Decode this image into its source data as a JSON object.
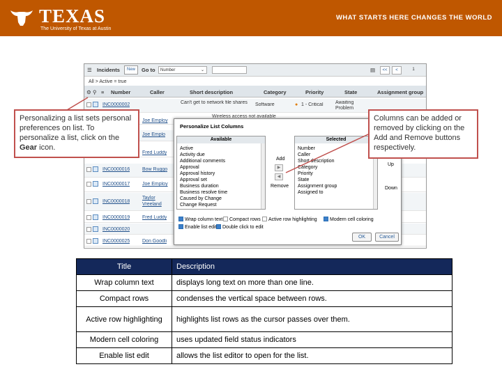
{
  "banner": {
    "logo_word": "TEXAS",
    "logo_sub": "The University of Texas at Austin",
    "tagline": "WHAT STARTS HERE CHANGES THE WORLD",
    "color": "#bf5700"
  },
  "screenshot": {
    "toolbar": {
      "list_name": "Incidents",
      "new_label": "New",
      "goto_label": "Go to",
      "goto_select": "Number",
      "first_page": "<<",
      "prev_page": "<",
      "page_number": "1"
    },
    "breadcrumb": "All > Active = true",
    "columns": [
      "Number",
      "Caller",
      "Short description",
      "Category",
      "Priority",
      "State",
      "Assignment group"
    ],
    "rows": [
      {
        "number": "INC0000002",
        "caller": "",
        "short_description": "Can't get to network file shares",
        "category": "Software",
        "priority": "1 - Critical",
        "state": "Awaiting Problem"
      },
      {
        "number": "",
        "caller": "Joe Employ",
        "short_description": "Wireless access not available",
        "category": "",
        "priority": "",
        "state": ""
      },
      {
        "number": "",
        "caller": "Joe Emplo",
        "short_description": "",
        "category": "",
        "priority": "",
        "state": ""
      },
      {
        "number": "",
        "caller": "Fred Luddy",
        "short_description": "",
        "category": "",
        "priority": "",
        "state": ""
      },
      {
        "number": "INC0000016",
        "caller": "Bow Ruggo",
        "short_description": "",
        "category": "",
        "priority": "",
        "state": ""
      },
      {
        "number": "INC0000017",
        "caller": "Joe Employ",
        "short_description": "",
        "category": "",
        "priority": "",
        "state": ""
      },
      {
        "number": "INC0000018",
        "caller": "Taylor Vreeland",
        "short_description": "",
        "category": "",
        "priority": "",
        "state": ""
      },
      {
        "number": "INC0000019",
        "caller": "Fred Luddy",
        "short_description": "",
        "category": "",
        "priority": "",
        "state": ""
      },
      {
        "number": "INC0000020",
        "caller": "",
        "short_description": "",
        "category": "",
        "priority": "",
        "state": ""
      },
      {
        "number": "INC0000025",
        "caller": "Don Goodli",
        "short_description": "",
        "category": "",
        "priority": "",
        "state": ""
      }
    ],
    "dialog": {
      "title": "Personalize List Columns",
      "available_header": "Available",
      "selected_header": "Selected",
      "available": [
        "Active",
        "Activity due",
        "Additional comments",
        "Approval",
        "Approval history",
        "Approval set",
        "Business duration",
        "Business resolve time",
        "Caused by Change",
        "Change Request"
      ],
      "selected": [
        "Number",
        "Caller",
        "Short description",
        "Category",
        "Priority",
        "State",
        "Assignment group",
        "Assigned to"
      ],
      "add_label": "Add",
      "remove_label": "Remove",
      "up_label": "Up",
      "down_label": "Down",
      "options": {
        "wrap": "Wrap column text",
        "compact": "Compact rows",
        "highlight": "Active row highlighting",
        "modern": "Modern cell coloring",
        "edit": "Enable list edit",
        "dblclick": "Double click to edit"
      },
      "ok_label": "OK",
      "cancel_label": "Cancel"
    }
  },
  "callouts": {
    "left_text": "Personalizing a list sets personal preferences on list. To personalize a list, click on the",
    "left_bold": "Gear",
    "left_end": "icon.",
    "right_text": "Columns can be added or removed by clicking on the Add and Remove buttons respectively.",
    "border_color": "#c0504d"
  },
  "table": {
    "header_title": "Title",
    "header_description": "Description",
    "rows": [
      {
        "title": "Wrap column text",
        "description": "displays long text on more than one line."
      },
      {
        "title": "Compact rows",
        "description": "condenses the vertical space between rows."
      },
      {
        "title": "Active row highlighting",
        "description": "highlights list rows as the cursor passes over them."
      },
      {
        "title": "Modern cell coloring",
        "description": "uses updated field status indicators"
      },
      {
        "title": "Enable list edit",
        "description": "allows the list editor to open for the list."
      }
    ],
    "header_color": "#14285a"
  }
}
